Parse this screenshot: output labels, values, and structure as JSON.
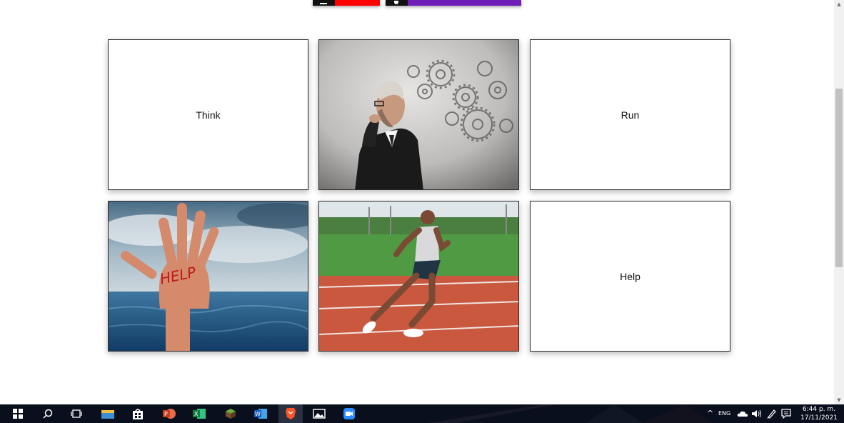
{
  "top_buttons": [
    {
      "name": "left",
      "accent": "#ff0000"
    },
    {
      "name": "right",
      "accent": "#6f1fb8"
    }
  ],
  "cards": [
    {
      "kind": "text",
      "label": "Think"
    },
    {
      "kind": "image",
      "image": "thinking-man-with-gears"
    },
    {
      "kind": "text",
      "label": "Run"
    },
    {
      "kind": "image",
      "image": "drowning-hand-help"
    },
    {
      "kind": "image",
      "image": "running-athlete"
    },
    {
      "kind": "text",
      "label": "Help"
    }
  ],
  "hand_text": "HELP",
  "scrollbar": {
    "up_icon": "▲",
    "down_icon": "▼"
  },
  "taskbar": {
    "icons": [
      "windows-start-icon",
      "search-icon",
      "task-view-icon",
      "file-explorer-icon",
      "store-icon",
      "powerpoint-icon",
      "excel-icon",
      "minecraft-icon",
      "word-icon",
      "brave-icon",
      "photos-icon",
      "zoom-icon"
    ],
    "tray": {
      "chevron": "^",
      "keyboard": "ENG",
      "clock_time": "6:44 p. m.",
      "clock_date": "17/11/2021"
    }
  }
}
